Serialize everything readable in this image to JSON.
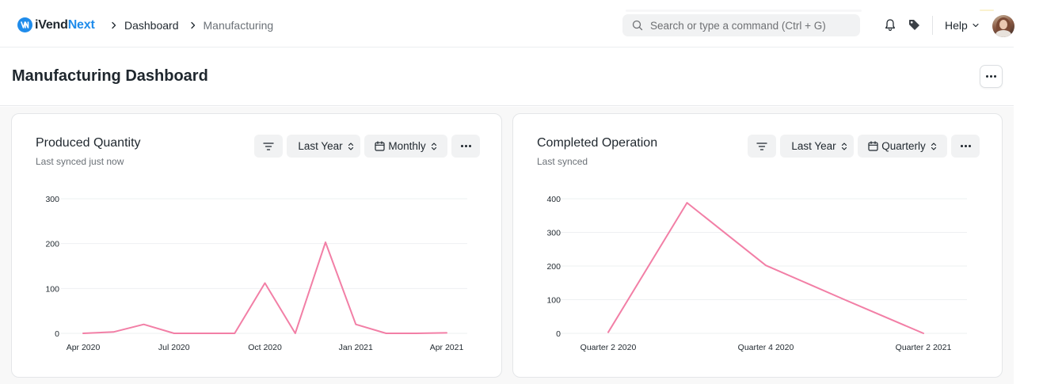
{
  "navbar": {
    "brand_part1": "iVend",
    "brand_part2": "Next",
    "breadcrumbs": [
      "Dashboard",
      "Manufacturing"
    ],
    "search_placeholder": "Search or type a command (Ctrl + G)",
    "help_label": "Help",
    "icons": [
      "logo-icon",
      "chevron-right-icon",
      "search-icon",
      "bell-icon",
      "tag-icon",
      "chevron-down-icon",
      "avatar"
    ]
  },
  "page": {
    "title": "Manufacturing Dashboard"
  },
  "colors": {
    "accent": "#1f8ceb",
    "series_line": "#f27fa6",
    "grid": "#eef0f2"
  },
  "cards": [
    {
      "title": "Produced Quantity",
      "subtitle": "Last synced just now",
      "range_label": "Last Year",
      "interval_label": "Monthly"
    },
    {
      "title": "Completed Operation",
      "subtitle": "Last synced",
      "range_label": "Last Year",
      "interval_label": "Quarterly"
    }
  ],
  "chart_data": [
    {
      "type": "line",
      "title": "Produced Quantity",
      "x": [
        "Apr 2020",
        "May 2020",
        "Jun 2020",
        "Jul 2020",
        "Aug 2020",
        "Sep 2020",
        "Oct 2020",
        "Nov 2020",
        "Dec 2020",
        "Jan 2021",
        "Feb 2021",
        "Mar 2021",
        "Apr 2021"
      ],
      "x_tick_labels": [
        "Apr 2020",
        "Jul 2020",
        "Oct 2020",
        "Jan 2021",
        "Apr 2021"
      ],
      "series": [
        {
          "values": [
            0,
            3,
            20,
            0,
            0,
            0,
            112,
            0,
            203,
            20,
            0,
            0,
            1
          ]
        }
      ],
      "y_ticks": [
        0,
        100,
        200,
        300
      ],
      "ylim": [
        0,
        300
      ],
      "grid": true,
      "legend": "none"
    },
    {
      "type": "line",
      "title": "Completed Operation",
      "x": [
        "Quarter 2 2020",
        "Quarter 3 2020",
        "Quarter 4 2020",
        "Quarter 1 2021",
        "Quarter 2 2021"
      ],
      "x_tick_labels": [
        "Quarter 2 2020",
        "Quarter 4 2020",
        "Quarter 2 2021"
      ],
      "series": [
        {
          "values": [
            3,
            388,
            202,
            100,
            0
          ]
        }
      ],
      "y_ticks": [
        0,
        100,
        200,
        300,
        400
      ],
      "ylim": [
        0,
        400
      ],
      "grid": true,
      "legend": "none"
    }
  ]
}
